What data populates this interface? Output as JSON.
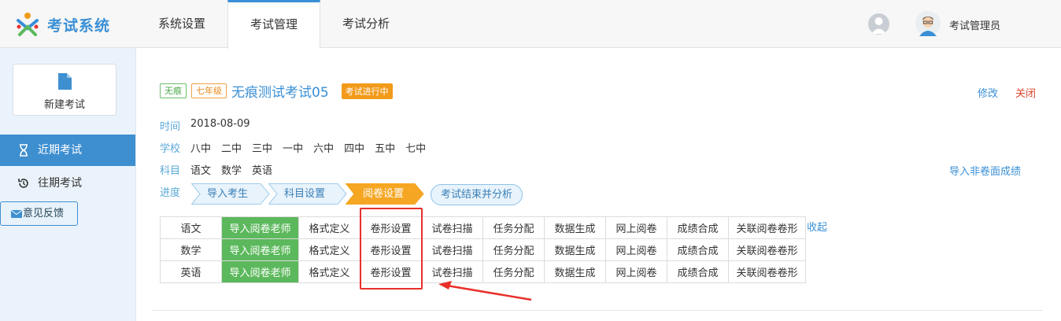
{
  "app": {
    "logo_text": "考试系统",
    "nav": [
      "系统设置",
      "考试管理",
      "考试分析"
    ],
    "user_name": "考试管理员"
  },
  "sidebar": {
    "new_exam_label": "新建考试",
    "items": [
      {
        "label": "近期考试",
        "icon": "hourglass-icon"
      },
      {
        "label": "往期考试",
        "icon": "history-icon"
      }
    ],
    "feedback_label": "意见反馈"
  },
  "exam": {
    "tag_traceless": "无痕",
    "tag_grade": "七年级",
    "title": "无痕测试考试05",
    "status": "考试进行中",
    "edit_label": "修改",
    "close_label": "关闭",
    "time_key": "时间",
    "time_value": "2018-08-09",
    "school_key": "学校",
    "schools": [
      "八中",
      "二中",
      "三中",
      "一中",
      "六中",
      "四中",
      "五中",
      "七中"
    ],
    "subject_key": "科目",
    "subjects": [
      "语文",
      "数学",
      "英语"
    ],
    "import_nonpaper_label": "导入非卷面成绩",
    "progress_key": "进度",
    "steps": [
      "导入考生",
      "科目设置",
      "阅卷设置"
    ],
    "final_step": "考试结束并分析"
  },
  "table": {
    "rows": [
      {
        "subject": "语文",
        "cells": [
          "导入阅卷老师",
          "格式定义",
          "卷形设置",
          "试卷扫描",
          "任务分配",
          "数据生成",
          "网上阅卷",
          "成绩合成",
          "关联阅卷卷形"
        ]
      },
      {
        "subject": "数学",
        "cells": [
          "导入阅卷老师",
          "格式定义",
          "卷形设置",
          "试卷扫描",
          "任务分配",
          "数据生成",
          "网上阅卷",
          "成绩合成",
          "关联阅卷卷形"
        ]
      },
      {
        "subject": "英语",
        "cells": [
          "导入阅卷老师",
          "格式定义",
          "卷形设置",
          "试卷扫描",
          "任务分配",
          "数据生成",
          "网上阅卷",
          "成绩合成",
          "关联阅卷卷形"
        ]
      }
    ],
    "collapse_label": "收起"
  },
  "colors": {
    "accent": "#3a8fd6",
    "teacher_cell": "#5cb85c",
    "status": "#f29a1a",
    "highlight": "#e8302a",
    "active_step": "#f5a623"
  }
}
